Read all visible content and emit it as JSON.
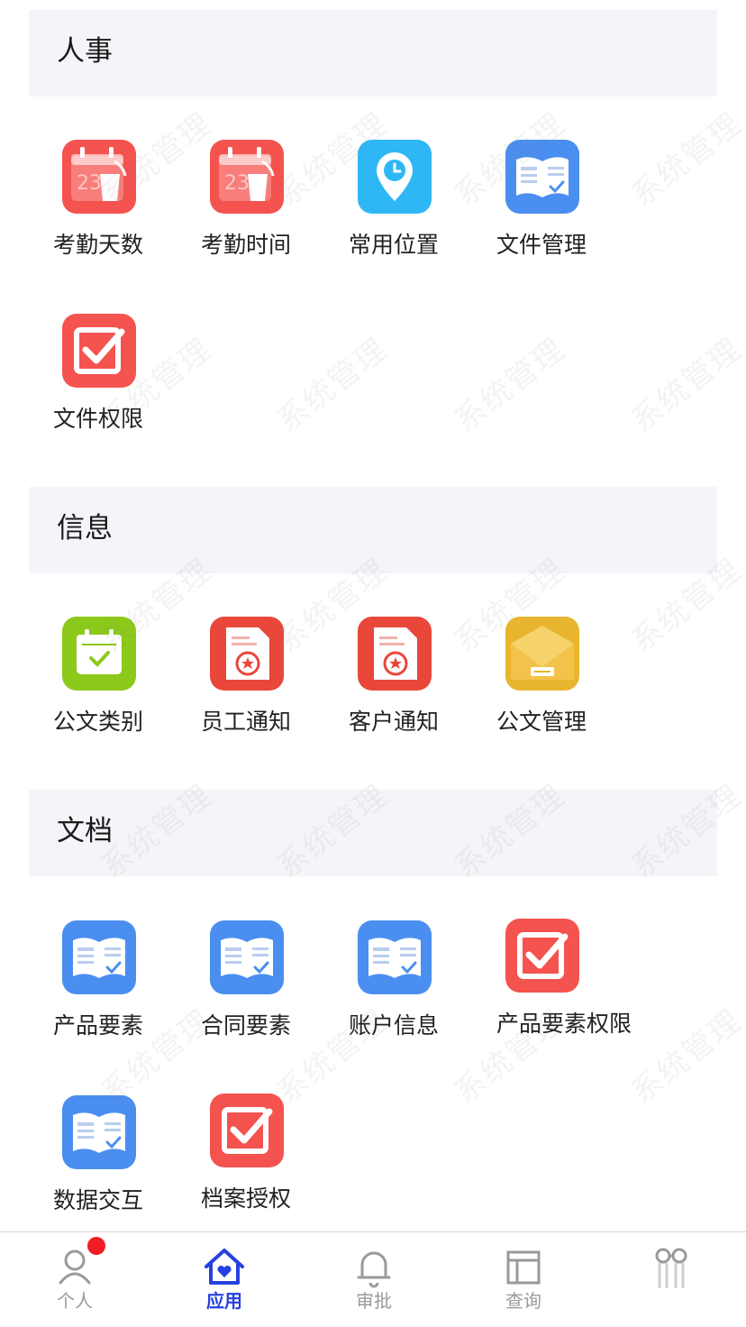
{
  "sections": [
    {
      "title": "人事",
      "items": [
        {
          "label": "考勤天数",
          "icon": "calendar-cup-icon"
        },
        {
          "label": "考勤时间",
          "icon": "calendar-cup-icon"
        },
        {
          "label": "常用位置",
          "icon": "location-clock-icon"
        },
        {
          "label": "文件管理",
          "icon": "book-check-icon"
        },
        {
          "label": "文件权限",
          "icon": "checkbox-icon"
        }
      ]
    },
    {
      "title": "信息",
      "items": [
        {
          "label": "公文类别",
          "icon": "calendar-check-icon"
        },
        {
          "label": "员工通知",
          "icon": "document-seal-icon"
        },
        {
          "label": "客户通知",
          "icon": "document-seal-icon"
        },
        {
          "label": "公文管理",
          "icon": "envelope-icon"
        }
      ]
    },
    {
      "title": "文档",
      "items": [
        {
          "label": "产品要素",
          "icon": "book-check-icon"
        },
        {
          "label": "合同要素",
          "icon": "book-check-icon"
        },
        {
          "label": "账户信息",
          "icon": "book-check-icon"
        },
        {
          "label": "产品要素权限",
          "icon": "checkbox-icon"
        },
        {
          "label": "数据交互",
          "icon": "book-check-icon"
        },
        {
          "label": "档案授权",
          "icon": "checkbox-icon"
        }
      ]
    }
  ],
  "watermark": "系统管理",
  "tabbar": [
    {
      "label": "个人",
      "icon": "person-icon",
      "badge": true
    },
    {
      "label": "应用",
      "icon": "home-heart-icon",
      "active": true
    },
    {
      "label": "审批",
      "icon": "bell-icon"
    },
    {
      "label": "查询",
      "icon": "layout-icon"
    },
    {
      "label": "",
      "icon": "glasses-icon"
    }
  ],
  "colors": {
    "accent": "#2540e0",
    "icon_red": "#f4534f",
    "icon_blue": "#4a8ef0",
    "icon_cyan": "#2fb7f5",
    "icon_green": "#8cc91a",
    "icon_yellow": "#e9b52e",
    "section_bg": "#f4f5f9",
    "badge": "#f21c24"
  }
}
